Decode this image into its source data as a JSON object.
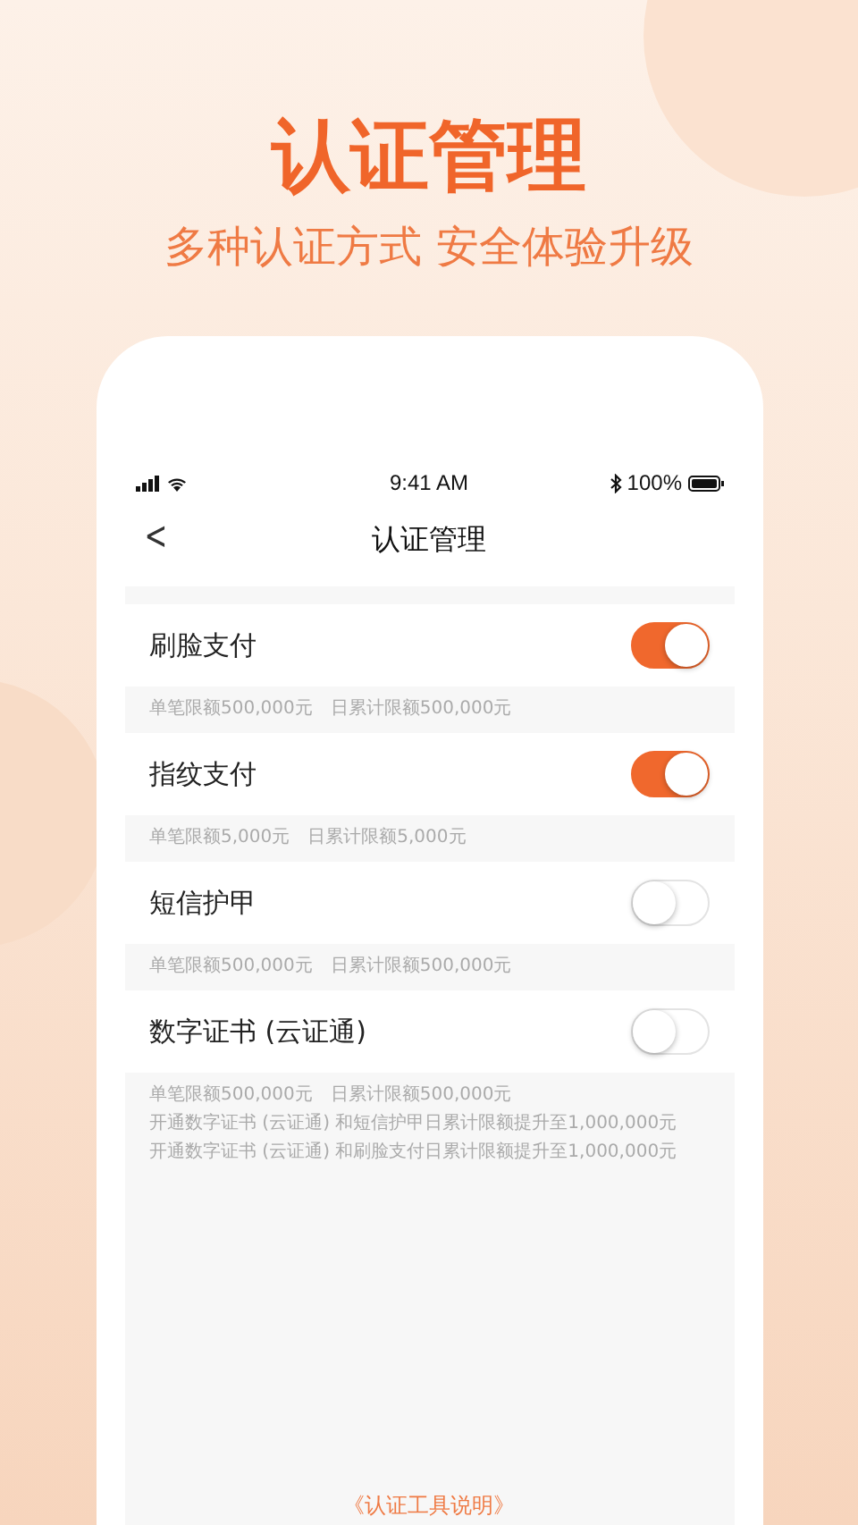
{
  "headline": "认证管理",
  "tagline": "多种认证方式 安全体验升级",
  "status_bar": {
    "time": "9:41 AM",
    "battery": "100%"
  },
  "nav": {
    "back": "<",
    "title": "认证管理"
  },
  "settings": [
    {
      "label": "刷脸支付",
      "on": true,
      "notes": [
        "单笔限额500,000元　日累计限额500,000元"
      ]
    },
    {
      "label": "指纹支付",
      "on": true,
      "notes": [
        "单笔限额5,000元　日累计限额5,000元"
      ]
    },
    {
      "label": "短信护甲",
      "on": false,
      "notes": [
        "单笔限额500,000元　日累计限额500,000元"
      ]
    },
    {
      "label": "数字证书 (云证通)",
      "on": false,
      "notes": [
        "单笔限额500,000元　日累计限额500,000元",
        "开通数字证书 (云证通) 和短信护甲日累计限额提升至1,000,000元",
        "开通数字证书 (云证通) 和刷脸支付日累计限额提升至1,000,000元"
      ]
    }
  ],
  "footer_link": "《认证工具说明》"
}
